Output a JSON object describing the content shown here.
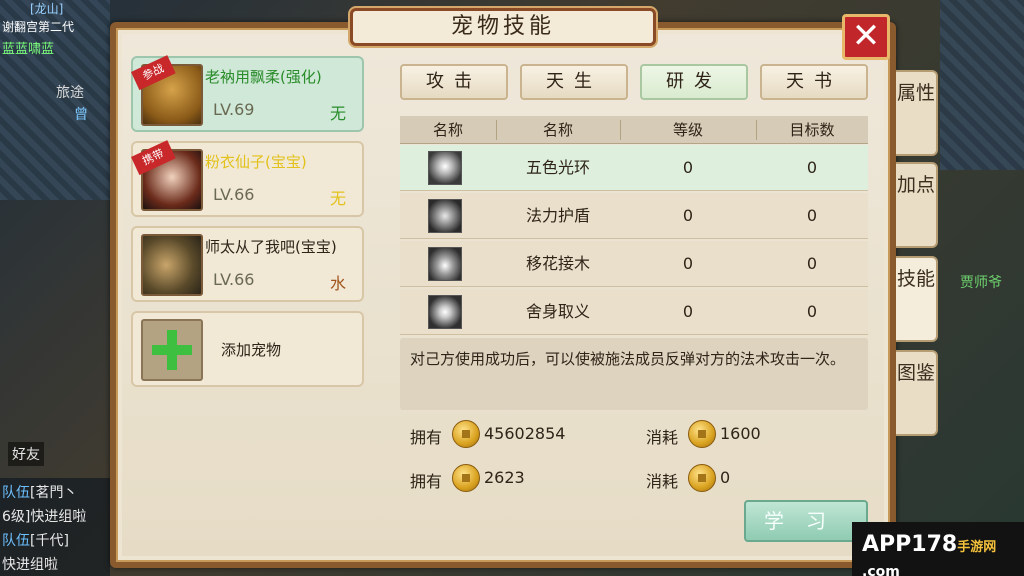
{
  "background": {
    "npc_names": [
      "曾",
      "贾师爷",
      "旅途"
    ],
    "top_chat": [
      "[龙山]",
      "谢翻宫第二代",
      "蓝蓝啸蓝"
    ],
    "friends_label": "好友"
  },
  "chat": {
    "lines": [
      {
        "channel": "队伍",
        "text": "[茗門丶"
      },
      {
        "channel": "",
        "text": "6级]快进组啦"
      },
      {
        "channel": "队伍",
        "text": "[千代]"
      },
      {
        "channel": "",
        "text": "快进组啦"
      }
    ]
  },
  "panel": {
    "title": "宠物技能",
    "close_symbol": "✕"
  },
  "pets": [
    {
      "name": "老衲用飘柔(强化)",
      "level": "LV.69",
      "element": "无",
      "badge": "参战",
      "selected": true,
      "name_color": "#2a8c2a",
      "element_color": "#2a8c2a"
    },
    {
      "name": "粉衣仙子(宝宝)",
      "level": "LV.66",
      "element": "无",
      "badge": "携带",
      "selected": false,
      "name_color": "#e2c21a",
      "element_color": "#e2c21a"
    },
    {
      "name": "师太从了我吧(宝宝)",
      "level": "LV.66",
      "element": "水",
      "badge": "",
      "selected": false,
      "name_color": "#2e2418",
      "element_color": "#a0541a"
    }
  ],
  "add_pet_label": "添加宠物",
  "tabs": [
    "攻击",
    "天生",
    "研发",
    "天书"
  ],
  "active_tab": 2,
  "table": {
    "headers": [
      "名称",
      "名称",
      "等级",
      "目标数"
    ],
    "rows": [
      {
        "name": "五色光环",
        "level": "0",
        "targets": "0",
        "icon": "halo-skill-icon"
      },
      {
        "name": "法力护盾",
        "level": "0",
        "targets": "0",
        "icon": "swirl-shield-skill-icon"
      },
      {
        "name": "移花接木",
        "level": "0",
        "targets": "0",
        "icon": "figure-skill-icon"
      },
      {
        "name": "舍身取义",
        "level": "0",
        "targets": "0",
        "icon": "burst-skill-icon"
      }
    ]
  },
  "description": "对己方使用成功后，可以使被施法成员反弹对方的法术攻击一次。",
  "resources": {
    "own_label_1": "拥有",
    "own_value_1": "45602854",
    "cost_label_1": "消耗",
    "cost_value_1": "1600",
    "own_label_2": "拥有",
    "own_value_2": "2623",
    "cost_label_2": "消耗",
    "cost_value_2": "0"
  },
  "learn_button": "学习",
  "side_tabs": [
    "属性",
    "加点",
    "技能",
    "图鉴"
  ],
  "active_side_tab": 2,
  "watermark": {
    "brand": "APP178",
    "cn": "手游网",
    "domain": ".com"
  }
}
